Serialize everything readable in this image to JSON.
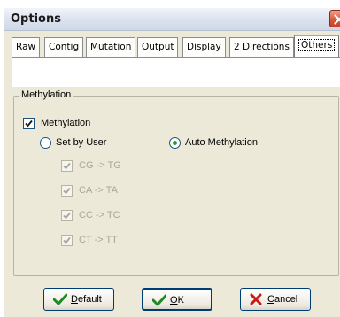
{
  "window": {
    "title": "Options"
  },
  "tabs": [
    {
      "label": "Raw",
      "active": false
    },
    {
      "label": "Contig",
      "active": false
    },
    {
      "label": "Mutation",
      "active": false
    },
    {
      "label": "Output",
      "active": false
    },
    {
      "label": "Display",
      "active": false
    },
    {
      "label": "2 Directions",
      "active": false
    },
    {
      "label": "Others",
      "active": true
    }
  ],
  "methylation": {
    "group_label": "Methylation",
    "enable_label": "Methylation",
    "enable_checked": true,
    "set_by_user_label": "Set by User",
    "auto_label": "Auto Methylation",
    "selected_mode": "auto",
    "conversions": [
      {
        "label": "CG -> TG",
        "checked": true,
        "enabled": false
      },
      {
        "label": "CA -> TA",
        "checked": true,
        "enabled": false
      },
      {
        "label": "CC -> TC",
        "checked": true,
        "enabled": false
      },
      {
        "label": "CT -> TT",
        "checked": true,
        "enabled": false
      }
    ]
  },
  "buttons": {
    "default": {
      "mnemonic": "D",
      "rest": "efault"
    },
    "ok": {
      "mnemonic": "O",
      "rest": "K"
    },
    "cancel": {
      "mnemonic": "C",
      "rest": "ancel"
    }
  },
  "colors": {
    "tab_active_accent": "#e6a020",
    "dialog_background": "#ece9d8",
    "check_green": "#1f8a1f",
    "cancel_red": "#c81818"
  }
}
